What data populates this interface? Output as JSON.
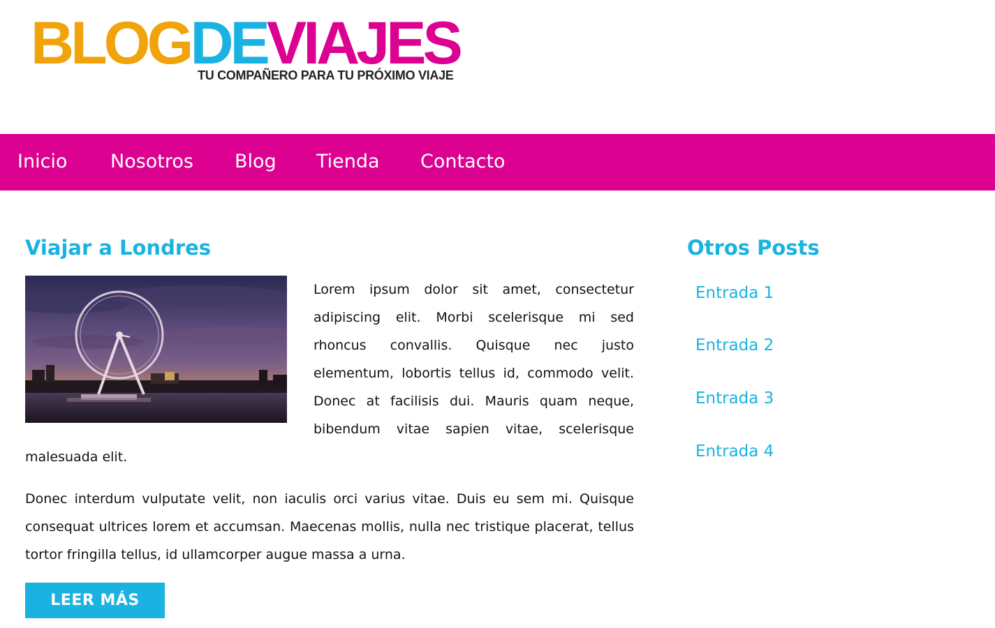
{
  "logo": {
    "word1": "BLOG",
    "word2": "DE",
    "word3": "VIAJES",
    "tagline": "TU COMPAÑERO PARA TU PRÓXIMO VIAJE",
    "colors": {
      "orange": "#f0a30a",
      "cyan": "#1ab2e0",
      "magenta": "#dc0190"
    }
  },
  "nav": {
    "background": "#dc0190",
    "items": [
      {
        "label": "Inicio"
      },
      {
        "label": "Nosotros"
      },
      {
        "label": "Blog"
      },
      {
        "label": "Tienda"
      },
      {
        "label": "Contacto"
      }
    ]
  },
  "post": {
    "title": "Viajar a Londres",
    "image_icon": "london-eye-photo",
    "paragraph1_wrap": "Lorem ipsum dolor sit amet, consectetur adipiscing elit. Morbi scelerisque mi sed rhoncus convallis. Quisque nec justo elementum, lobortis tellus id, commodo velit. Donec at facilisis dui. Mauris quam neque, bibendum vitae sapien vitae, scelerisque",
    "paragraph1_tail": "malesuada elit.",
    "paragraph2": "Donec interdum vulputate velit, non iaculis orci varius vitae. Duis eu sem mi. Quisque consequat ultrices lorem et accumsan. Maecenas mollis, nulla nec tristique placerat, tellus tortor fringilla tellus, id ullamcorper augue massa a urna.",
    "button_label": "LEER MÁS"
  },
  "sidebar": {
    "title": "Otros Posts",
    "links": [
      {
        "label": "Entrada 1"
      },
      {
        "label": "Entrada 2"
      },
      {
        "label": "Entrada 3"
      },
      {
        "label": "Entrada 4"
      }
    ]
  }
}
